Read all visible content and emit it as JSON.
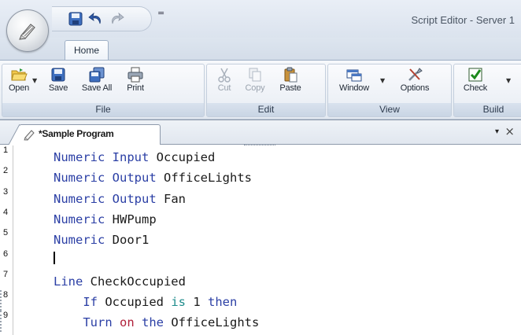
{
  "window": {
    "title": "Script Editor - Server 1"
  },
  "quick_access": {
    "save_icon": "save-icon",
    "undo_icon": "undo-icon",
    "redo_icon": "redo-icon",
    "more": "="
  },
  "ribbon": {
    "tabs": [
      "Home"
    ],
    "groups": [
      {
        "label": "File",
        "buttons": [
          {
            "label": "Open",
            "icon": "open-folder-icon",
            "dropdown": true
          },
          {
            "label": "Save",
            "icon": "save-icon"
          },
          {
            "label": "Save All",
            "icon": "save-all-icon"
          },
          {
            "label": "Print",
            "icon": "print-icon"
          }
        ]
      },
      {
        "label": "Edit",
        "buttons": [
          {
            "label": "Cut",
            "icon": "cut-icon",
            "disabled": true
          },
          {
            "label": "Copy",
            "icon": "copy-icon",
            "disabled": true
          },
          {
            "label": "Paste",
            "icon": "paste-icon"
          }
        ]
      },
      {
        "label": "View",
        "buttons": [
          {
            "label": "Window",
            "icon": "window-icon",
            "dropdown": true
          },
          {
            "label": "Options",
            "icon": "options-icon"
          }
        ]
      },
      {
        "label": "Build",
        "buttons": [
          {
            "label": "Check",
            "icon": "check-icon",
            "dropdown": true
          }
        ]
      }
    ]
  },
  "document": {
    "tab_label": "*Sample Program",
    "dropdown": "▾",
    "close": "×"
  },
  "editor": {
    "lines": [
      {
        "num": "1",
        "tokens": [
          {
            "t": "Numeric",
            "c": "kw"
          },
          {
            "t": " "
          },
          {
            "t": "Input",
            "c": "kw"
          },
          {
            "t": " Occupied"
          }
        ]
      },
      {
        "num": "2",
        "tokens": [
          {
            "t": "Numeric",
            "c": "kw"
          },
          {
            "t": " "
          },
          {
            "t": "Output",
            "c": "kw"
          },
          {
            "t": " OfficeLights"
          }
        ]
      },
      {
        "num": "3",
        "tokens": [
          {
            "t": "Numeric",
            "c": "kw"
          },
          {
            "t": " "
          },
          {
            "t": "Output",
            "c": "kw"
          },
          {
            "t": " Fan"
          }
        ]
      },
      {
        "num": "4",
        "tokens": [
          {
            "t": "Numeric",
            "c": "kw"
          },
          {
            "t": " HWPump"
          }
        ]
      },
      {
        "num": "5",
        "tokens": [
          {
            "t": "Numeric",
            "c": "kw"
          },
          {
            "t": " Door1"
          }
        ]
      },
      {
        "num": "6",
        "tokens": [],
        "caret": true
      },
      {
        "num": "7",
        "tokens": [
          {
            "t": "Line",
            "c": "kw"
          },
          {
            "t": " CheckOccupied"
          }
        ]
      },
      {
        "num": "8",
        "tokens": [
          {
            "t": "    "
          },
          {
            "t": "If",
            "c": "kw"
          },
          {
            "t": " Occupied "
          },
          {
            "t": "is",
            "c": "kw-teal"
          },
          {
            "t": " 1 "
          },
          {
            "t": "then",
            "c": "kw"
          }
        ]
      },
      {
        "num": "9",
        "tokens": [
          {
            "t": "    "
          },
          {
            "t": "Turn",
            "c": "kw"
          },
          {
            "t": " "
          },
          {
            "t": "on",
            "c": "kw-red"
          },
          {
            "t": " "
          },
          {
            "t": "the",
            "c": "kw"
          },
          {
            "t": " OfficeLights"
          }
        ]
      }
    ]
  }
}
